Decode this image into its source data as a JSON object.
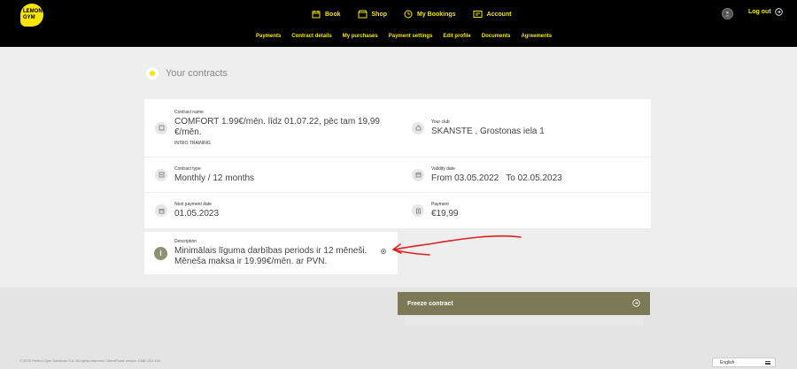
{
  "header": {
    "logo_line1": "LEMON",
    "logo_line2": "GYM",
    "nav": [
      {
        "label": "Book",
        "icon": "calendar-icon"
      },
      {
        "label": "Shop",
        "icon": "shop-icon"
      },
      {
        "label": "My Bookings",
        "icon": "bookings-icon"
      },
      {
        "label": "Account",
        "icon": "account-icon"
      }
    ],
    "subnav": [
      "Payments",
      "Contract details",
      "My purchases",
      "Payment settings",
      "Edit profile",
      "Documents",
      "Agreements"
    ],
    "logout_label": "Log out"
  },
  "section": {
    "title": "Your contracts"
  },
  "contract": {
    "name_label": "Contract name",
    "name_value": "COMFORT 1.99€/mēn. līdz 01.07.22, pēc tam 19,99 €/mēn.",
    "name_sub": "INTRO TRAINING",
    "club_label": "Your club",
    "club_value": "SKANSTE , Grostonas iela 1",
    "type_label": "Contract type",
    "type_value": "Monthly / 12 months",
    "validity_label": "Validity date",
    "validity_value": "From 03.05.2022   To 02.05.2023",
    "next_payment_label": "Next payment date",
    "next_payment_value": "01.05.2023",
    "payment_label": "Payment",
    "payment_value": "€19,99",
    "description_label": "Description",
    "description_value": "Minimālais līguma darbības periods ir 12 mēneši. Mēneša maksa ir 19.99€/mēn. ar PVN."
  },
  "actions": {
    "freeze_label": "Freeze contract"
  },
  "footer": {
    "copyright": "© 2023 Perfect Gym Solutions S.A. All rights reserved. ClientPortal version 4.880.214.434",
    "language": "English"
  },
  "colors": {
    "brand_yellow": "#f5e500",
    "header_bg": "#000000",
    "freeze_bg": "#7c7a56",
    "annotation_red": "#e02020"
  }
}
